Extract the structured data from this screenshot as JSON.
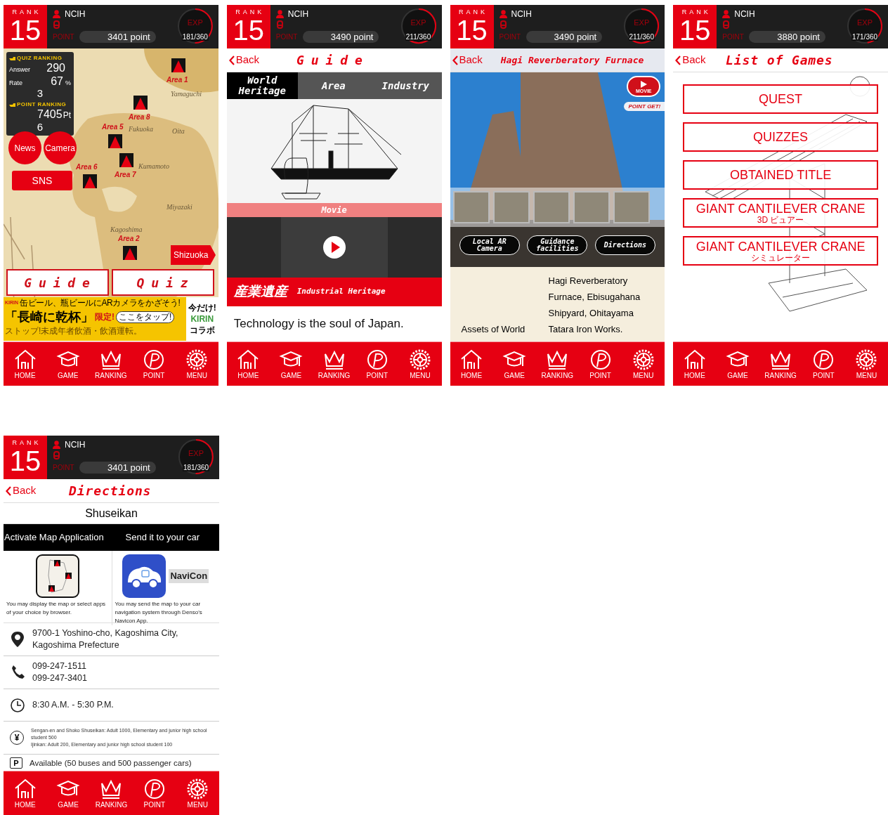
{
  "screens": [
    {
      "kind": "home",
      "header": {
        "rank_label": "RANK",
        "rank": "15",
        "user": "NCIH",
        "point_label": "POINT",
        "points": "3401 point",
        "exp": {
          "label": "EXP",
          "reading": "181/360"
        }
      },
      "quiz_ranking": {
        "title": "QUIZ RANKING",
        "answer_label": "Answer",
        "answer": "290",
        "rate_label": "Rate",
        "rate": "67",
        "rate_unit": "%",
        "rank": "3"
      },
      "point_ranking": {
        "title": "POINT RANKING",
        "points": "7405",
        "unit": "Pt",
        "rank": "6"
      },
      "map_places": [
        "Yamaguchi",
        "Fukuoka",
        "Oita",
        "Kumamoto",
        "Miyazaki",
        "Kagoshima"
      ],
      "areas": [
        "Area 1",
        "Area 8",
        "Area 5",
        "Area 7",
        "Area 6",
        "Area 2"
      ],
      "round_buttons": [
        "News",
        "Camera"
      ],
      "sns_button": "SNS",
      "next_region": "Shizuoka",
      "main_buttons": [
        "Guide",
        "Quiz"
      ],
      "ad": {
        "brand": "KIRIN",
        "headline": "缶ビール、瓶ビールにARカメラをかざそう!",
        "title": "「長崎に乾杯」",
        "badge": "限定!",
        "tap": "ここをタップ!",
        "notice": "ストップ!未成年者飲酒・飲酒運転。",
        "promo": [
          "今だけ!",
          "KIRIN",
          "コラボ"
        ]
      },
      "nav": [
        {
          "kind": "home",
          "label": "HOME"
        },
        {
          "kind": "game",
          "label": "GAME"
        },
        {
          "kind": "ranking",
          "label": "RANKING"
        },
        {
          "kind": "point",
          "label": "POINT"
        },
        {
          "kind": "menu",
          "label": "MENU"
        }
      ]
    },
    {
      "kind": "guide",
      "header": {
        "rank_label": "RANK",
        "rank": "15",
        "user": "NCIH",
        "point_label": "POINT",
        "points": "3490 point",
        "exp": {
          "label": "EXP",
          "reading": "211/360"
        }
      },
      "back": "Back",
      "title": "Guide",
      "tabs": [
        {
          "label": "World Heritage",
          "selected": true
        },
        {
          "label": "Area",
          "selected": false
        },
        {
          "label": "Industry",
          "selected": false
        }
      ],
      "movie_label": "Movie",
      "banner": {
        "title": "産業遺産",
        "subtitle": "Industrial Heritage"
      },
      "tagline": "Technology is the soul of Japan.",
      "nav": [
        {
          "kind": "home",
          "label": "HOME"
        },
        {
          "kind": "game",
          "label": "GAME"
        },
        {
          "kind": "ranking",
          "label": "RANKING"
        },
        {
          "kind": "point",
          "label": "POINT"
        },
        {
          "kind": "menu",
          "label": "MENU"
        }
      ]
    },
    {
      "kind": "site",
      "header": {
        "rank_label": "RANK",
        "rank": "15",
        "user": "NCIH",
        "point_label": "POINT",
        "points": "3490 point",
        "exp": {
          "label": "EXP",
          "reading": "211/360"
        }
      },
      "back": "Back",
      "title": "Hagi Reverberatory Furnace",
      "movie_button": "MOVIE",
      "point_tag": "POINT GET!",
      "actions": [
        "Local AR Camera",
        "Guidance facilities",
        "Directions"
      ],
      "caption": "Assets of World",
      "description": "Hagi Reverberatory Furnace, Ebisugahana Shipyard, Ohitayama Tatara Iron Works.",
      "nav": [
        {
          "kind": "home",
          "label": "HOME"
        },
        {
          "kind": "game",
          "label": "GAME"
        },
        {
          "kind": "ranking",
          "label": "RANKING"
        },
        {
          "kind": "point",
          "label": "POINT"
        },
        {
          "kind": "menu",
          "label": "MENU"
        }
      ]
    },
    {
      "kind": "games",
      "header": {
        "rank_label": "RANK",
        "rank": "15",
        "user": "NCIH",
        "point_label": "POINT",
        "points": "3880 point",
        "exp": {
          "label": "EXP",
          "reading": "171/360"
        }
      },
      "back": "Back",
      "title": "List of Games",
      "games": [
        {
          "label": "QUEST"
        },
        {
          "label": "QUIZZES"
        },
        {
          "label": "OBTAINED TITLE"
        },
        {
          "label": "GIANT CANTILEVER CRANE",
          "subtitle": "3D ビュアー"
        },
        {
          "label": "GIANT CANTILEVER CRANE",
          "subtitle": "シミュレーター"
        }
      ],
      "nav": [
        {
          "kind": "home",
          "label": "HOME"
        },
        {
          "kind": "game",
          "label": "GAME"
        },
        {
          "kind": "ranking",
          "label": "RANKING"
        },
        {
          "kind": "point",
          "label": "POINT"
        },
        {
          "kind": "menu",
          "label": "MENU"
        }
      ]
    },
    {
      "kind": "directions",
      "header": {
        "rank_label": "RANK",
        "rank": "15",
        "user": "NCIH",
        "point_label": "POINT",
        "points": "3401 point",
        "exp": {
          "label": "EXP",
          "reading": "181/360"
        }
      },
      "back": "Back",
      "title": "Directions",
      "place": "Shuseikan",
      "options": [
        {
          "heading": "Activate Map Application",
          "description": "You may display the map or select apps of your choice by browser."
        },
        {
          "heading": "Send it to your car",
          "app_name": "NaviCon",
          "description": "You may send the map to your car navigation system through Denso's Navicon App."
        }
      ],
      "info": [
        {
          "kind": "address",
          "lines": [
            "9700-1 Yoshino-cho, Kagoshima City,",
            "Kagoshima Prefecture"
          ]
        },
        {
          "kind": "phone",
          "lines": [
            "099-247-1511",
            "099-247-3401"
          ]
        },
        {
          "kind": "hours",
          "lines": [
            "8:30 A.M. - 5:30 P.M."
          ]
        },
        {
          "kind": "fee",
          "icon_text": "¥",
          "lines": [
            "Sengan-en and Shoko Shuseikan: Adult 1000, Elementary and junior high school student 500",
            "Ijinkan: Adult 200, Elementary and junior high school student 100"
          ]
        },
        {
          "kind": "parking",
          "icon_text": "P",
          "lines": [
            "Available (50 buses and 500 passenger cars)"
          ]
        }
      ],
      "nav": [
        {
          "kind": "home",
          "label": "HOME"
        },
        {
          "kind": "game",
          "label": "GAME"
        },
        {
          "kind": "ranking",
          "label": "RANKING"
        },
        {
          "kind": "point",
          "label": "POINT"
        },
        {
          "kind": "menu",
          "label": "MENU"
        }
      ]
    }
  ]
}
